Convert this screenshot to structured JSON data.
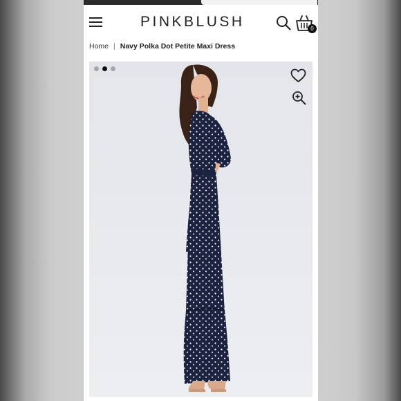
{
  "header": {
    "logo_text": "PINKBLUSH",
    "cart_count": "0"
  },
  "breadcrumb": {
    "home": "Home",
    "separator": "|",
    "current": "Navy Polka Dot Petite Maxi Dress"
  },
  "gallery": {
    "image_count": 3,
    "active_index": 1
  },
  "icons": {
    "menu": "hamburger-menu-icon",
    "search": "search-icon",
    "cart": "shopping-basket-icon",
    "wishlist": "heart-icon",
    "zoom": "zoom-in-icon"
  },
  "colors": {
    "dress": "#1c2340",
    "dots": "#ffffff",
    "gallery_background": "#e5e7ec",
    "text": "#222222"
  }
}
